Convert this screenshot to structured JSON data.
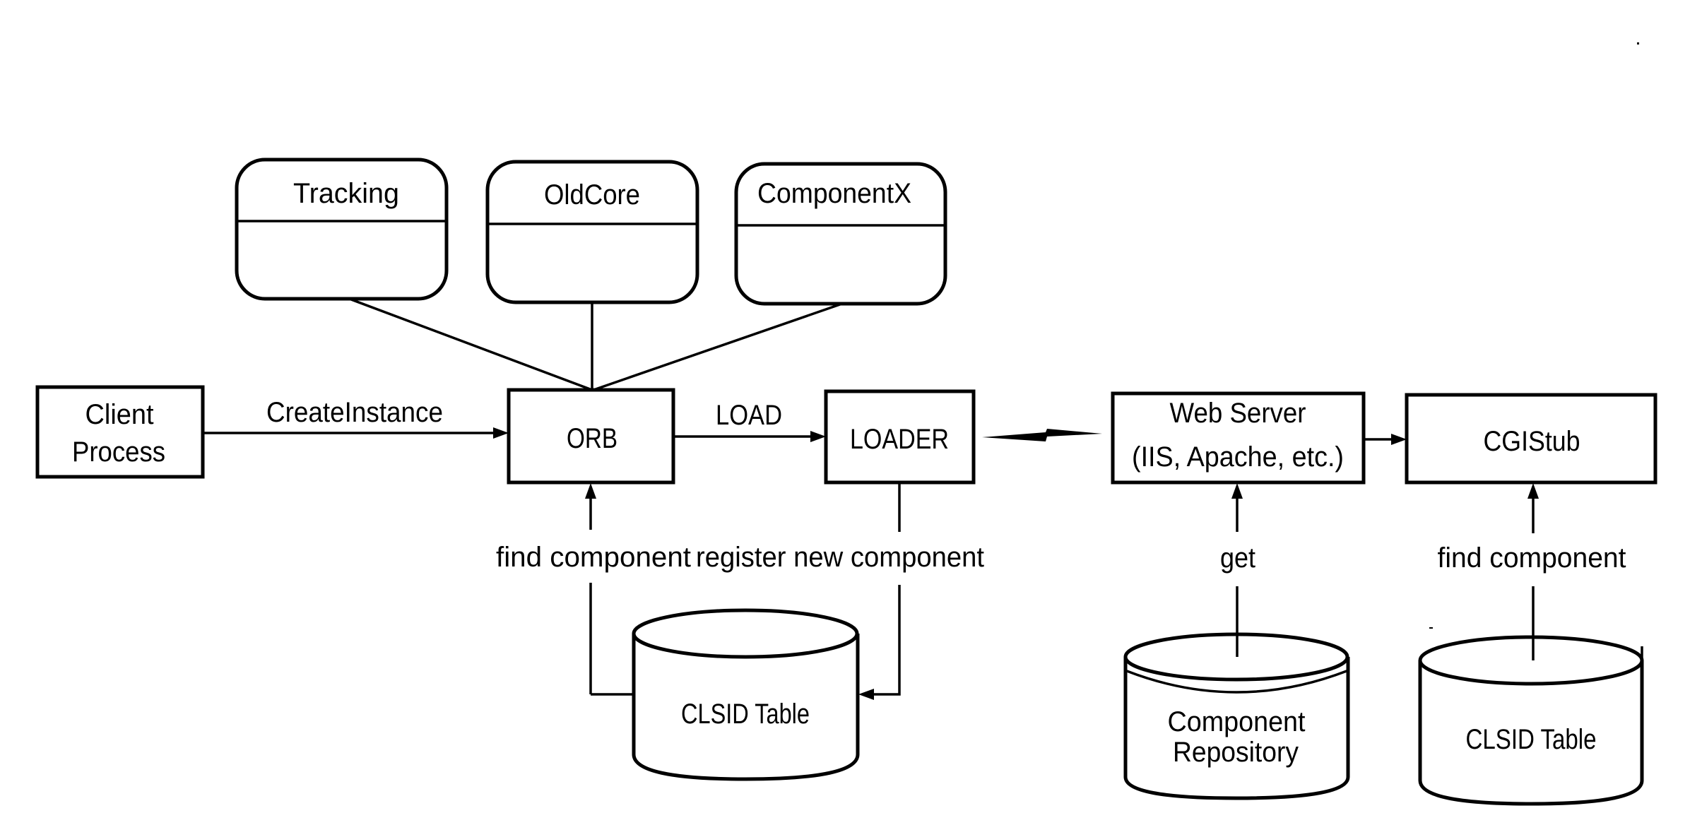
{
  "diagram": {
    "components": [
      {
        "id": "tracking",
        "label": "Tracking"
      },
      {
        "id": "oldcore",
        "label": "OldCore"
      },
      {
        "id": "componentx",
        "label": "ComponentX"
      }
    ],
    "client": {
      "line1": "Client",
      "line2": "Process"
    },
    "orb": {
      "label": "ORB"
    },
    "loader": {
      "label": "LOADER"
    },
    "web_server": {
      "line1": "Web Server",
      "line2": "(IIS, Apache, etc.)"
    },
    "cgistub": {
      "label": "CGIStub"
    },
    "clsid_table_left": {
      "label": "CLSID Table"
    },
    "component_repository": {
      "line1": "Component",
      "line2": "Repository"
    },
    "clsid_table_right": {
      "label": "CLSID Table"
    },
    "edges": {
      "create_instance": "CreateInstance",
      "load": "LOAD",
      "find_component_left": "find component",
      "register_new_component": "register new component",
      "get": "get",
      "find_component_right": "find component"
    }
  }
}
